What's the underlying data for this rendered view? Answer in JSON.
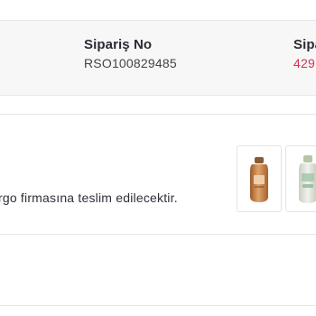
{
  "order_summary": {
    "order_no_label": "Sipariş No",
    "order_no_value": "RSO100829485",
    "next_label_partial": "Sipa",
    "next_value_partial": "429"
  },
  "shipment": {
    "message": "rgo firmasına teslim edilecektir.",
    "products": [
      {
        "icon": "shampoo-bottle-icon",
        "color": "#c57a3b"
      },
      {
        "icon": "conditioner-bottle-icon",
        "color": "#d9dccf"
      }
    ]
  }
}
